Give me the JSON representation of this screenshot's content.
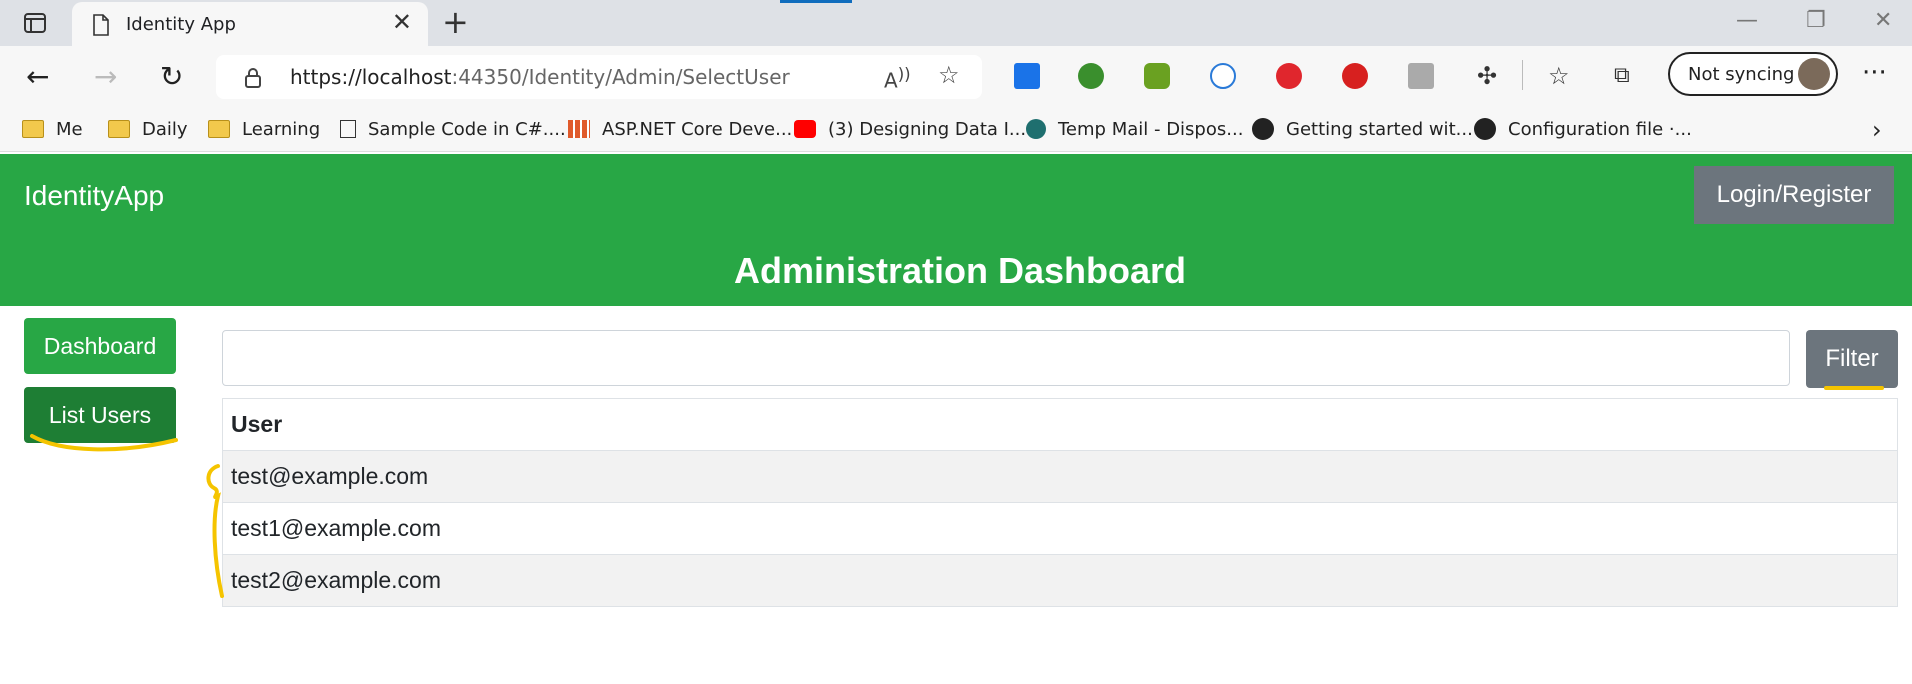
{
  "browser": {
    "tab_title": "Identity App",
    "url_host": "https://localhost",
    "url_path": ":44350/Identity/Admin/SelectUser",
    "sync_label": "Not syncing",
    "bookmarks": [
      {
        "label": "Me",
        "icon": "folder-icon"
      },
      {
        "label": "Daily",
        "icon": "folder-icon"
      },
      {
        "label": "Learning",
        "icon": "folder-icon"
      },
      {
        "label": "Sample Code in C#....",
        "icon": "page-icon"
      },
      {
        "label": "ASP.NET Core Deve...",
        "icon": "grid-icon"
      },
      {
        "label": "(3) Designing Data I...",
        "icon": "youtube-icon"
      },
      {
        "label": "Temp Mail - Dispos...",
        "icon": "tempmail-icon"
      },
      {
        "label": "Getting started wit...",
        "icon": "github-icon"
      },
      {
        "label": "Configuration file ·...",
        "icon": "github-icon"
      }
    ]
  },
  "header": {
    "brand": "IdentityApp",
    "login_label": "Login/Register",
    "title": "Administration Dashboard"
  },
  "sidebar": {
    "dashboard_label": "Dashboard",
    "list_users_label": "List Users"
  },
  "filter": {
    "value": "",
    "button_label": "Filter"
  },
  "table": {
    "header": "User",
    "rows": [
      "test@example.com",
      "test1@example.com",
      "test2@example.com"
    ]
  },
  "colors": {
    "header_green": "#28a745",
    "active_green": "#1e7e34",
    "secondary_gray": "#6c757d",
    "annotation_yellow": "#f5c400"
  }
}
